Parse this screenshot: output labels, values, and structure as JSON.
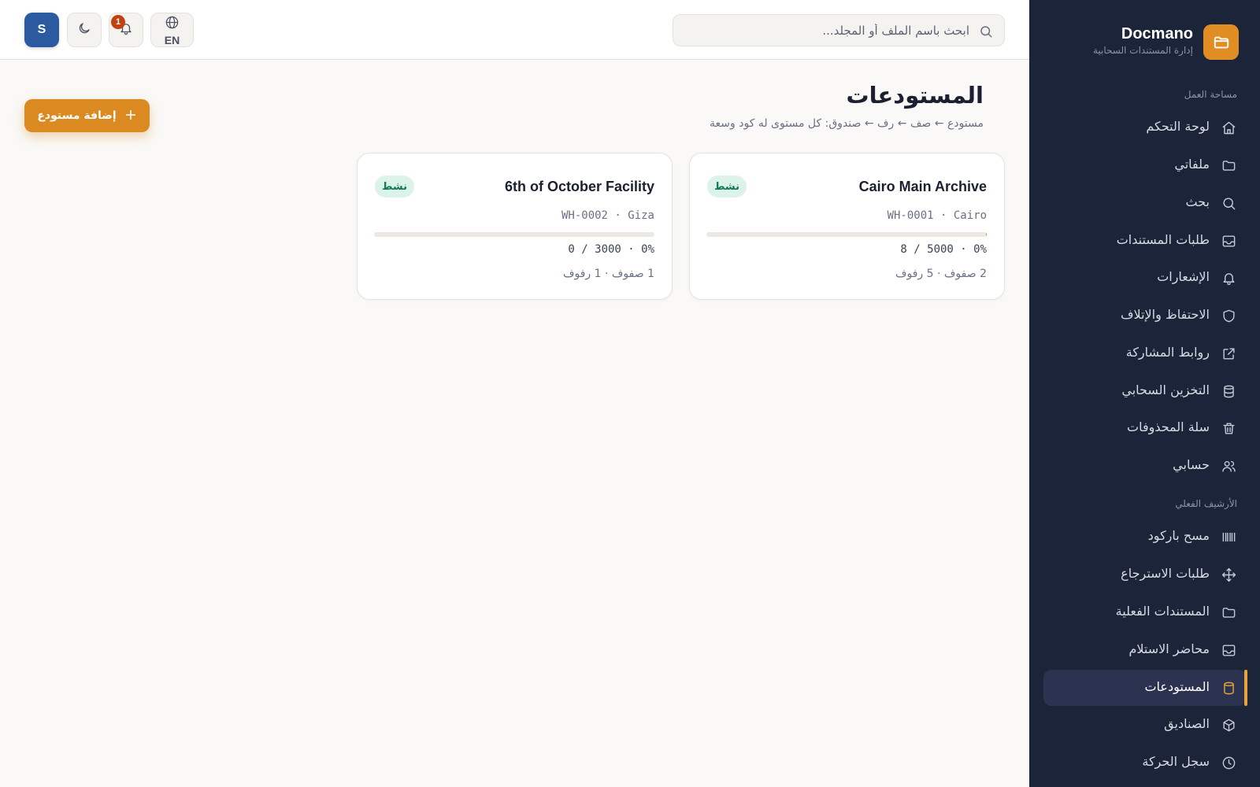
{
  "brand": {
    "name": "Docmano",
    "subtitle": "إدارة المستندات السحابية",
    "icon": "folder-icon"
  },
  "sidebar": {
    "workspace_label": "مساحة العمل",
    "workspace_items": [
      {
        "label": "لوحة التحكم",
        "icon": "home-icon"
      },
      {
        "label": "ملفاتي",
        "icon": "folder-icon"
      },
      {
        "label": "بحث",
        "icon": "search-icon"
      },
      {
        "label": "طلبات المستندات",
        "icon": "inbox-icon"
      },
      {
        "label": "الإشعارات",
        "icon": "bell-icon"
      },
      {
        "label": "الاحتفاظ والإتلاف",
        "icon": "shield-icon"
      },
      {
        "label": "روابط المشاركة",
        "icon": "external-link-icon"
      },
      {
        "label": "التخزين السحابي",
        "icon": "database-icon"
      },
      {
        "label": "سلة المحذوفات",
        "icon": "trash-icon"
      },
      {
        "label": "حسابي",
        "icon": "users-icon"
      }
    ],
    "archive_label": "الأرشيف الفعلي",
    "archive_items": [
      {
        "label": "مسح باركود",
        "icon": "barcode-icon"
      },
      {
        "label": "طلبات الاسترجاع",
        "icon": "move-icon"
      },
      {
        "label": "المستندات الفعلية",
        "icon": "folder-icon"
      },
      {
        "label": "محاضر الاستلام",
        "icon": "inbox-icon"
      },
      {
        "label": "المستودعات",
        "icon": "database-icon",
        "active": true
      },
      {
        "label": "الصناديق",
        "icon": "box-icon"
      },
      {
        "label": "سجل الحركة",
        "icon": "clock-icon"
      }
    ]
  },
  "topbar": {
    "search_placeholder": "ابحث باسم الملف أو المجلد...",
    "language": "EN",
    "notification_count": "1",
    "avatar_initial": "S"
  },
  "main": {
    "title": "المستودعات",
    "subtitle": "مستودع ← صف ← رف ← صندوق: كل مستوى له كود وسعة",
    "add_button": "إضافة مستودع",
    "warehouses": [
      {
        "name": "Cairo Main Archive",
        "status": "نشط",
        "code": "WH-0001 · Cairo",
        "capacity": "8 / 5000 · 0%",
        "used": 8,
        "total": 5000,
        "stats": "2 صفوف · 5 رفوف"
      },
      {
        "name": "6th of October Facility",
        "status": "نشط",
        "code": "WH-0002 · Giza",
        "capacity": "0 / 3000 · 0%",
        "used": 0,
        "total": 3000,
        "stats": "1 صفوف · 1 رفوف"
      }
    ]
  },
  "colors": {
    "sidebar_bg": "#1c2439",
    "accent": "#db8a22",
    "active_marker": "#e8a33a",
    "status_green": "#0f7a55",
    "status_bg": "#dcf3ea"
  }
}
